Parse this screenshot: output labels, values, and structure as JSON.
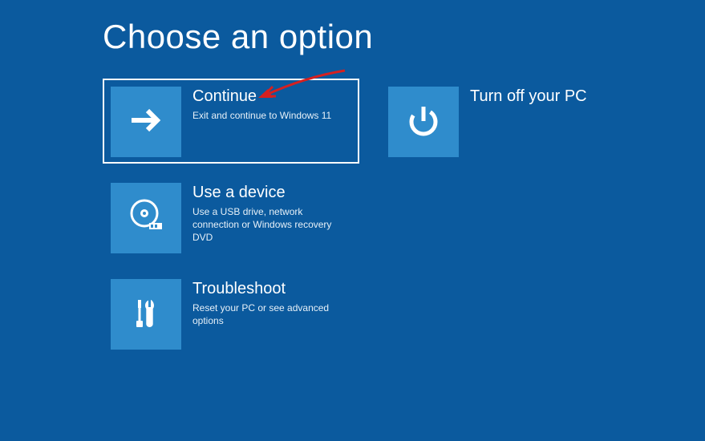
{
  "page": {
    "title": "Choose an option"
  },
  "options": {
    "continue": {
      "title": "Continue",
      "desc": "Exit and continue to Windows 11"
    },
    "turnoff": {
      "title": "Turn off your PC",
      "desc": ""
    },
    "use_device": {
      "title": "Use a device",
      "desc": "Use a USB drive, network connection or Windows recovery DVD"
    },
    "troubleshoot": {
      "title": "Troubleshoot",
      "desc": "Reset your PC or see advanced options"
    }
  },
  "colors": {
    "background": "#0b5a9e",
    "tile": "#2f8ccc",
    "text": "#ffffff",
    "annotation": "#d62020"
  }
}
